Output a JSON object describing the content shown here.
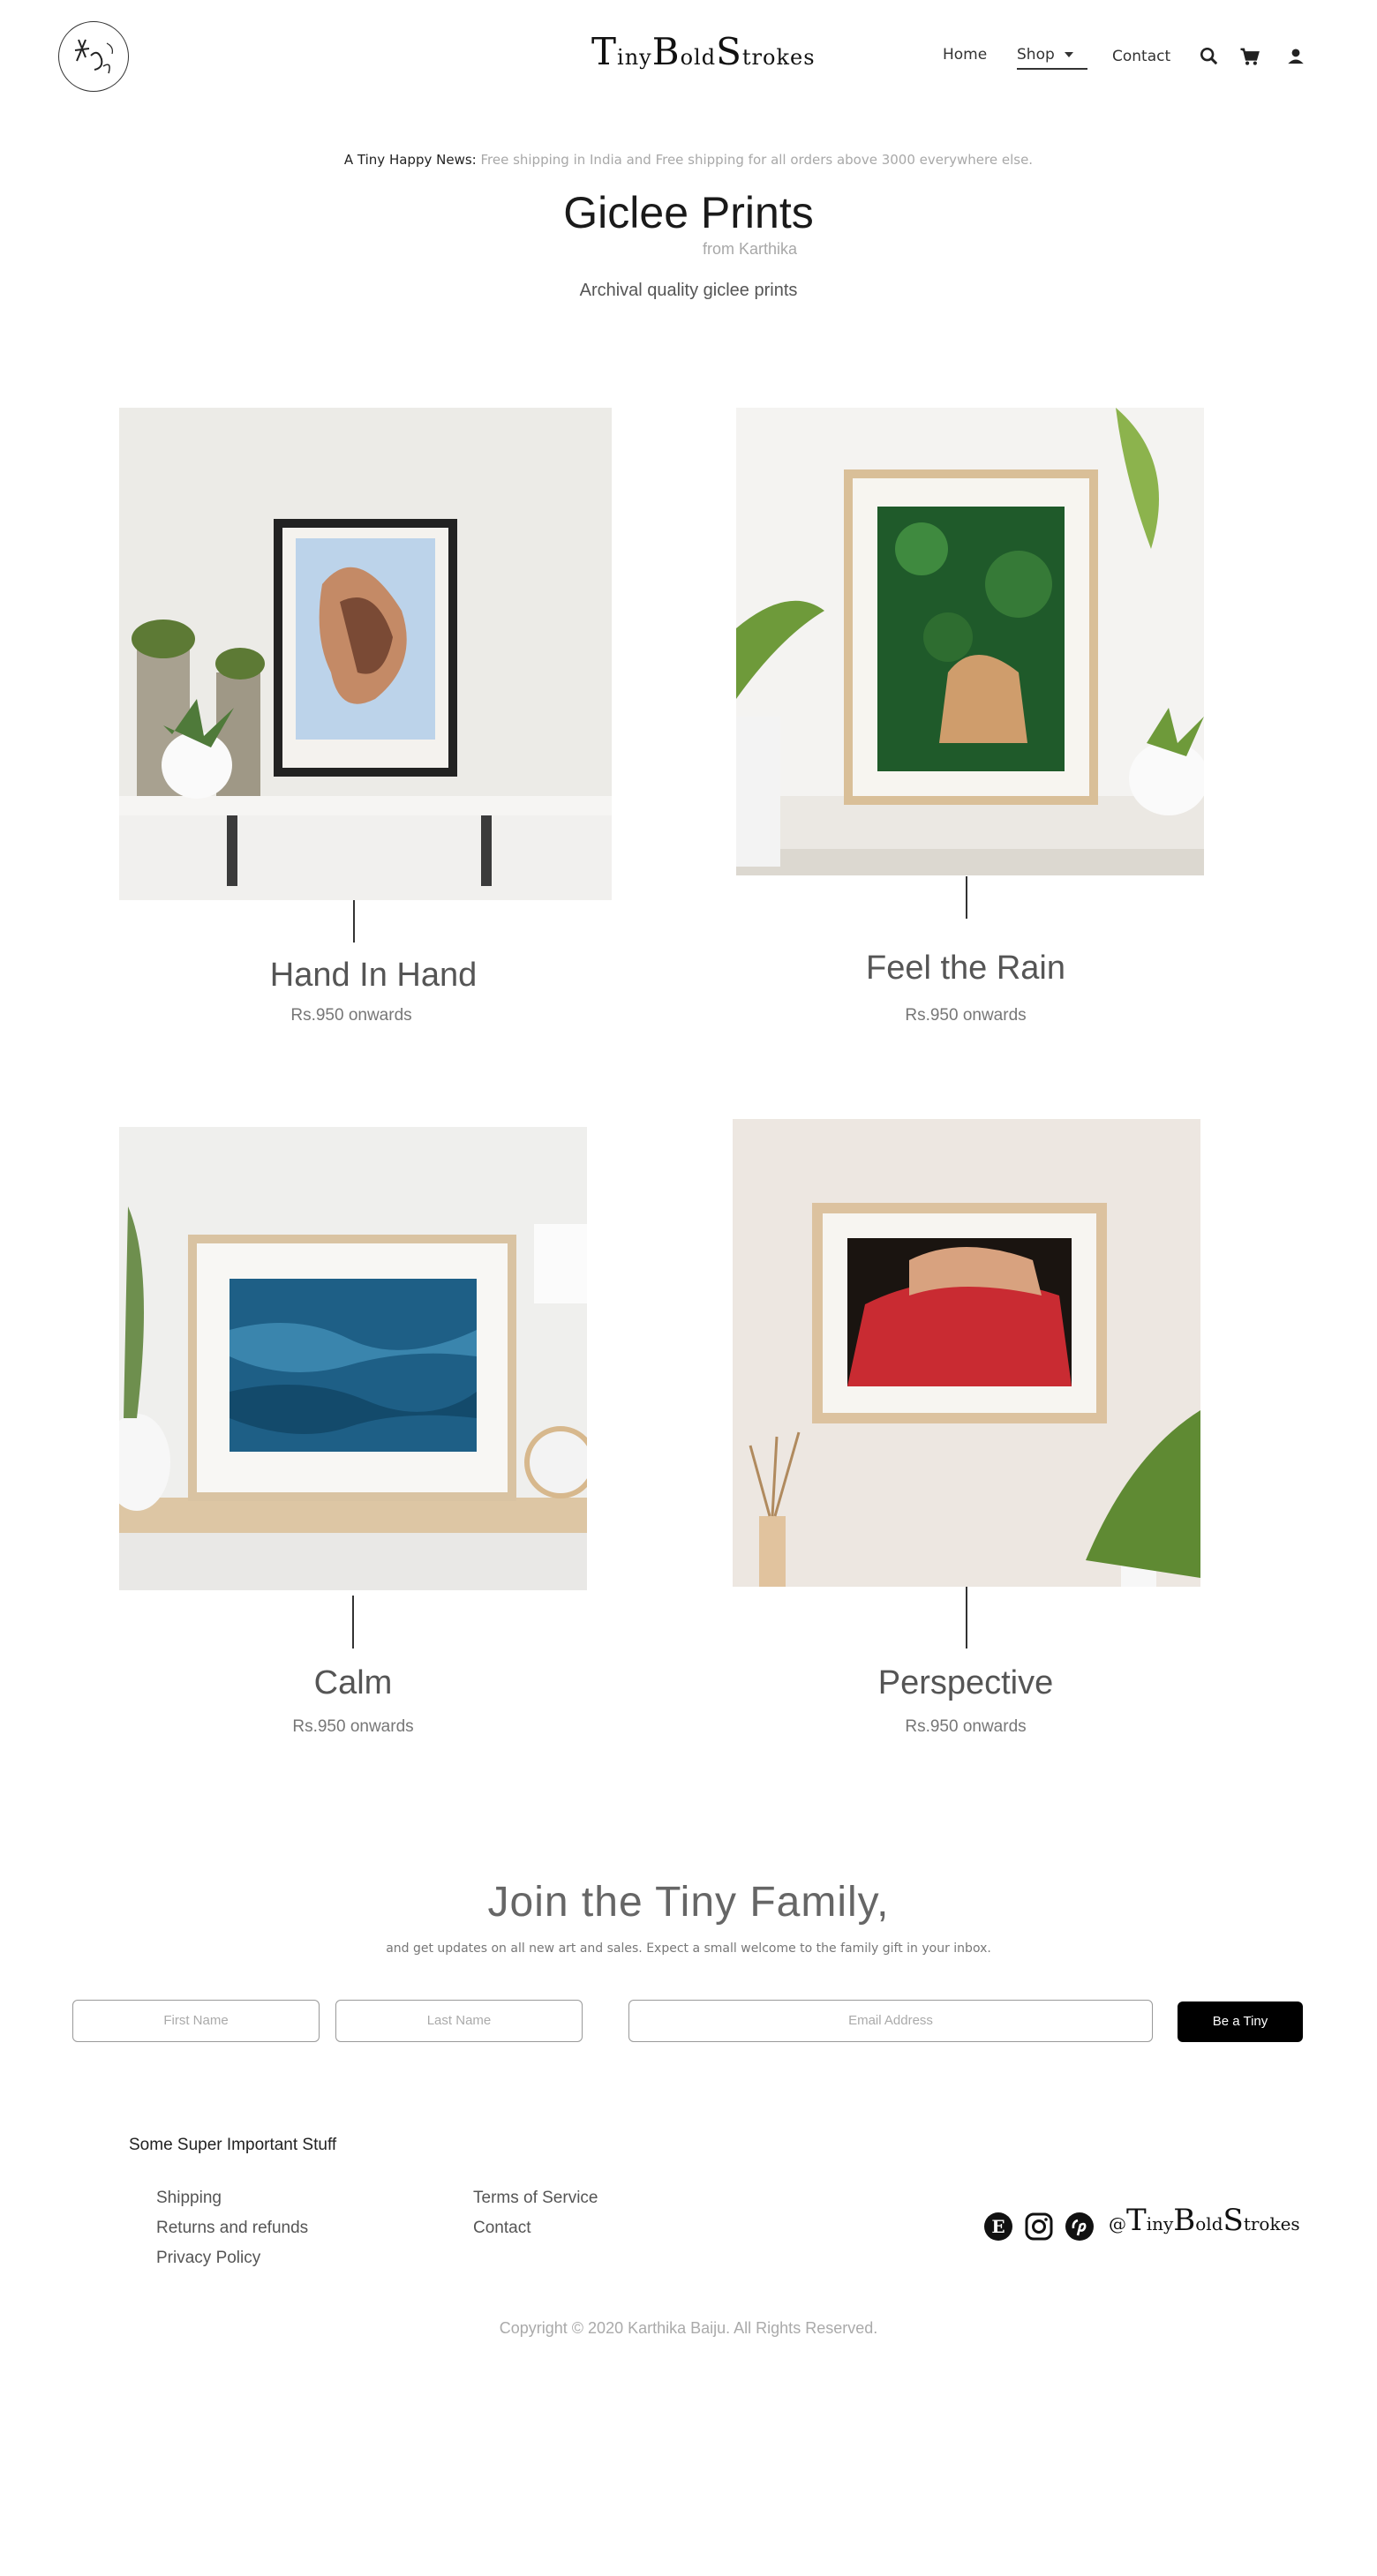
{
  "header": {
    "brand": {
      "t": "T",
      "iny": "iny",
      "b": "B",
      "old": "old",
      "s": "S",
      "trokes": "trokes"
    },
    "nav": {
      "home": "Home",
      "shop": "Shop",
      "contact": "Contact"
    },
    "icons": [
      "search-icon",
      "cart-icon",
      "account-icon"
    ]
  },
  "announcement": {
    "lead": "A Tiny Happy News:",
    "text": " Free shipping in India and Free shipping for all orders above 3000 everywhere else."
  },
  "collection": {
    "title": "Giclee Prints",
    "subtitle": "from Karthika",
    "description": "Archival quality giclee prints"
  },
  "products": [
    {
      "name": "Hand In Hand",
      "price": "Rs.950 onwards"
    },
    {
      "name": "Feel the Rain",
      "price": "Rs.950 onwards"
    },
    {
      "name": "Calm",
      "price": "Rs.950 onwards"
    },
    {
      "name": "Perspective",
      "price": "Rs.950 onwards"
    }
  ],
  "newsletter": {
    "title": "Join the Tiny Family,",
    "subtitle": "and get updates on all new art and sales. Expect a small welcome to the family gift in your inbox.",
    "first_name_placeholder": "First Name",
    "last_name_placeholder": "Last Name",
    "email_placeholder": "Email Address",
    "button": "Be a Tiny"
  },
  "footer": {
    "heading": "Some Super Important Stuff",
    "links_col1": [
      "Shipping",
      "Returns and refunds",
      "Privacy Policy"
    ],
    "links_col2": [
      "Terms of Service",
      "Contact"
    ],
    "social_icons": [
      "etsy-icon",
      "instagram-icon",
      "pinterest-icon"
    ],
    "handle": {
      "at": "@",
      "t": "T",
      "iny": "iny",
      "b": "B",
      "old": "old",
      "s": "S",
      "trokes": "trokes"
    },
    "copyright": "Copyright © 2020 Karthika Baiju. All Rights Reserved."
  },
  "colors": {
    "accent": "#000000",
    "muted": "#a8a8a8"
  }
}
